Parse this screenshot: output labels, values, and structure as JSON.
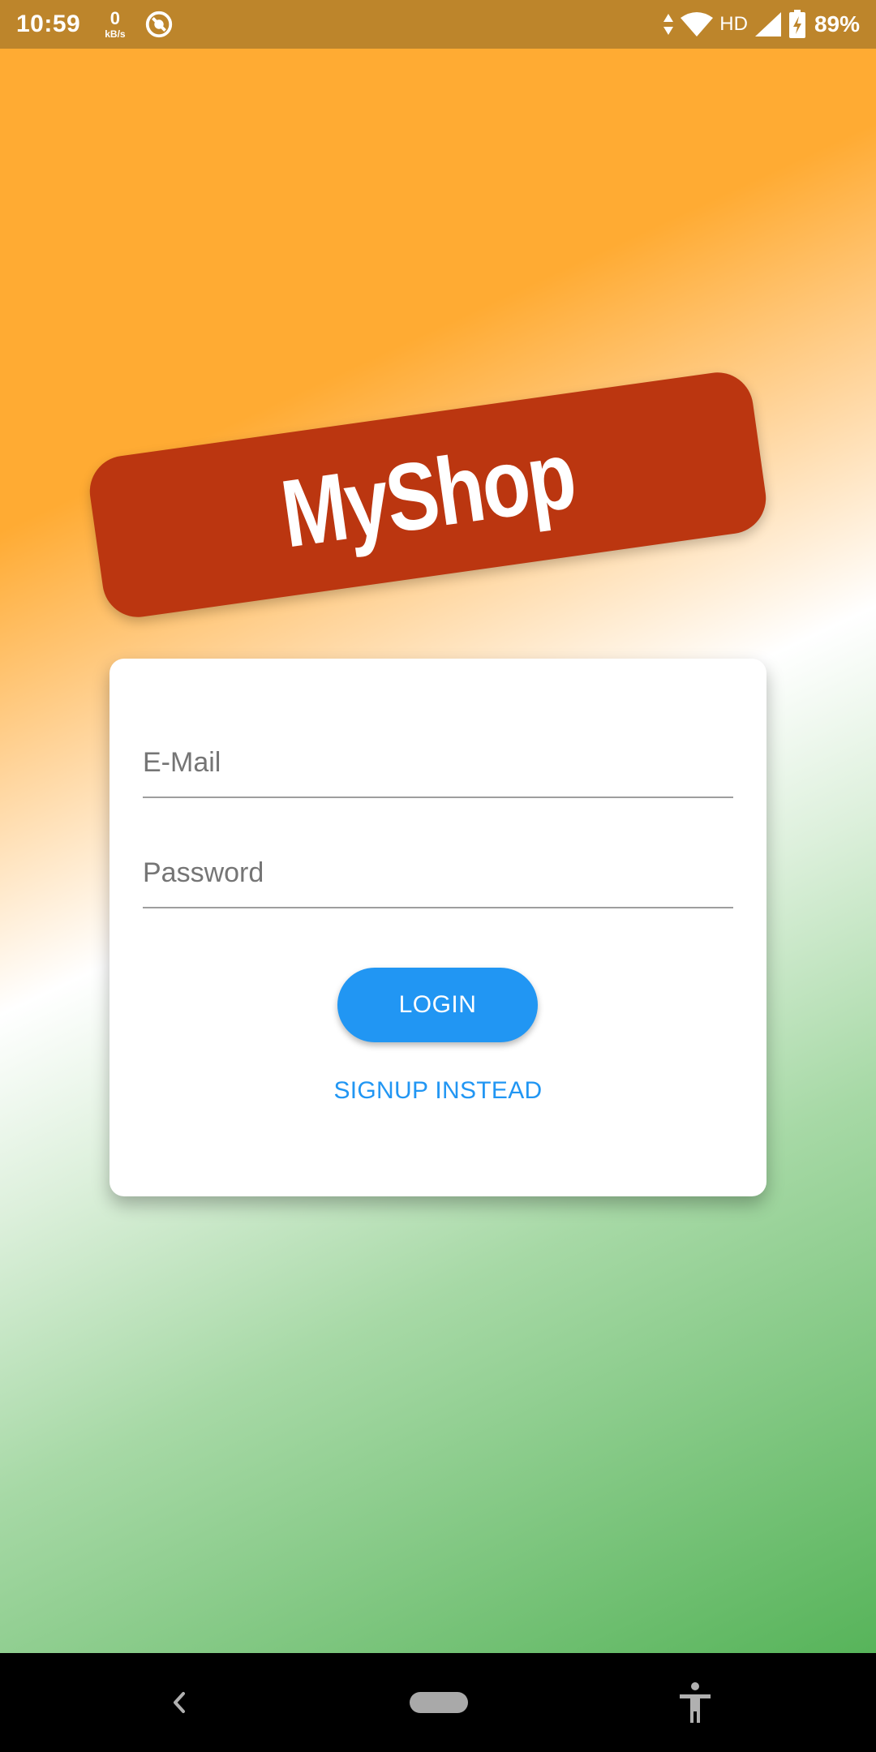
{
  "status_bar": {
    "time": "10:59",
    "net_speed_value": "0",
    "net_speed_unit": "kB/s",
    "network_type": "HD",
    "battery_percent": "89%",
    "icons": [
      "data-saver-icon",
      "data-arrows-icon",
      "wifi-icon",
      "signal-icon",
      "battery-charging-icon"
    ]
  },
  "app": {
    "title": "MyShop",
    "colors": {
      "banner": "#bb3610",
      "accent": "#2196f3",
      "gradient_top": "#ffab33",
      "gradient_bottom": "#57b45a"
    }
  },
  "form": {
    "email_placeholder": "E-Mail",
    "email_value": "",
    "password_placeholder": "Password",
    "password_value": "",
    "login_label": "LOGIN",
    "signup_label": "SIGNUP INSTEAD"
  },
  "nav_bar": {
    "icons": [
      "back-icon",
      "home-pill-icon",
      "accessibility-icon"
    ]
  }
}
